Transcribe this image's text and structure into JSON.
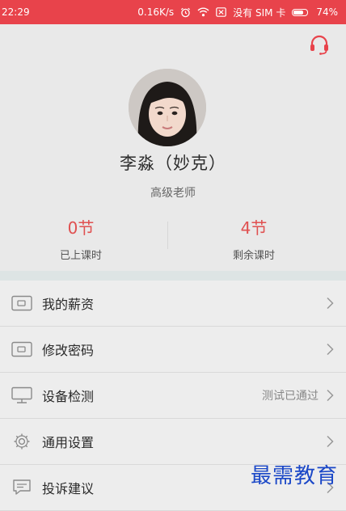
{
  "status_bar": {
    "time": "22:29",
    "net_speed": "0.16K/s",
    "sim_text": "没有 SIM 卡",
    "battery": "74%",
    "battery_level": 0.74
  },
  "profile": {
    "name": "李淼（妙克）",
    "title": "高级老师",
    "stats": [
      {
        "value": "0节",
        "label": "已上课时"
      },
      {
        "value": "4节",
        "label": "剩余课时"
      }
    ]
  },
  "menu": [
    {
      "label": "我的薪资",
      "icon": "wallet-icon",
      "extra": ""
    },
    {
      "label": "修改密码",
      "icon": "wallet-icon",
      "extra": ""
    },
    {
      "label": "设备检测",
      "icon": "monitor-icon",
      "extra": "测试已通过"
    },
    {
      "label": "通用设置",
      "icon": "gear-icon",
      "extra": ""
    },
    {
      "label": "投诉建议",
      "icon": "message-icon",
      "extra": ""
    }
  ],
  "watermark": "最需教育",
  "colors": {
    "accent": "#e8434b",
    "stat": "#e05050",
    "watermark": "#1a47c7"
  }
}
